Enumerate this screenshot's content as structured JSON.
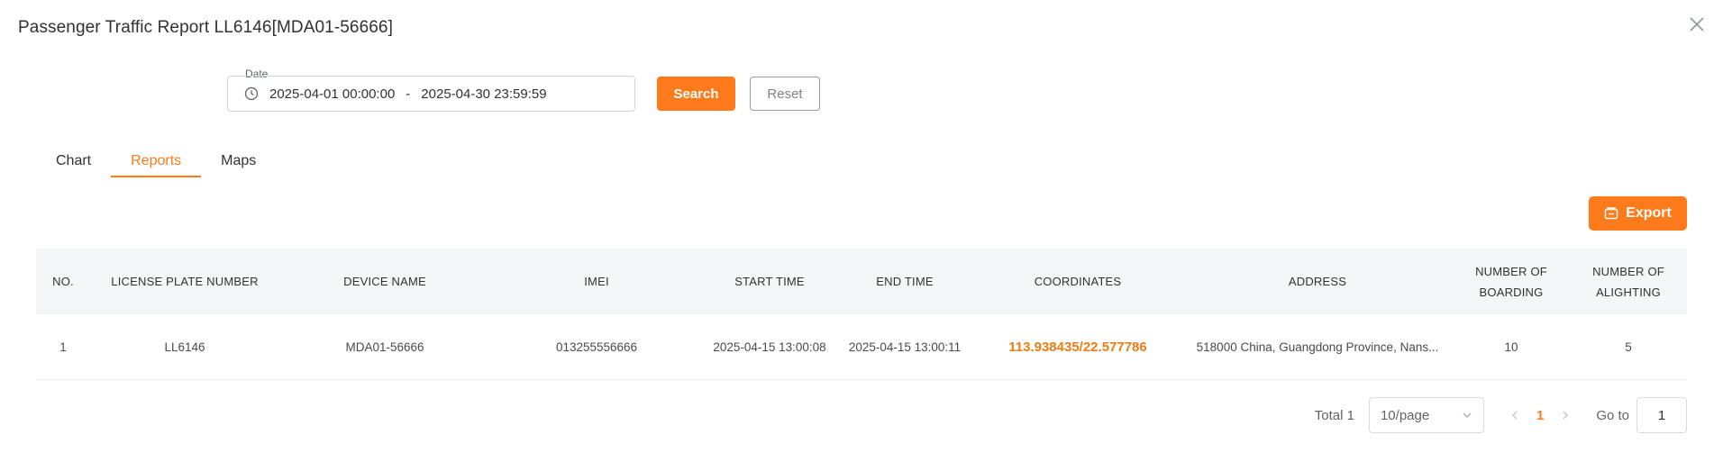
{
  "dialog": {
    "title": "Passenger Traffic Report LL6146[MDA01-56666]"
  },
  "filters": {
    "date_label": "Date",
    "date_start": "2025-04-01 00:00:00",
    "date_separator": "-",
    "date_end": "2025-04-30 23:59:59",
    "search_label": "Search",
    "reset_label": "Reset"
  },
  "tabs": [
    {
      "label": "Chart",
      "active": false
    },
    {
      "label": "Reports",
      "active": true
    },
    {
      "label": "Maps",
      "active": false
    }
  ],
  "toolbar": {
    "export_label": "Export"
  },
  "table": {
    "columns": {
      "no": "NO.",
      "license": "LICENSE PLATE NUMBER",
      "device": "DEVICE NAME",
      "imei": "IMEI",
      "start": "START TIME",
      "end": "END TIME",
      "coords": "COORDINATES",
      "address": "ADDRESS",
      "boarding": "NUMBER OF BOARDING",
      "alighting": "NUMBER OF ALIGHTING"
    },
    "rows": [
      {
        "no": "1",
        "license": "LL6146",
        "device": "MDA01-56666",
        "imei": "013255556666",
        "start": "2025-04-15 13:00:08",
        "end": "2025-04-15 13:00:11",
        "coords": "113.938435/22.577786",
        "address": "518000 China, Guangdong Province, Nans...",
        "boarding": "10",
        "alighting": "5"
      }
    ]
  },
  "pagination": {
    "total_text": "Total 1",
    "page_size": "10/page",
    "current_page": "1",
    "goto_label": "Go to",
    "goto_value": "1"
  },
  "colors": {
    "accent": "#ff7a1a",
    "link": "#f07b12",
    "header_bg": "#f5f6f8"
  }
}
